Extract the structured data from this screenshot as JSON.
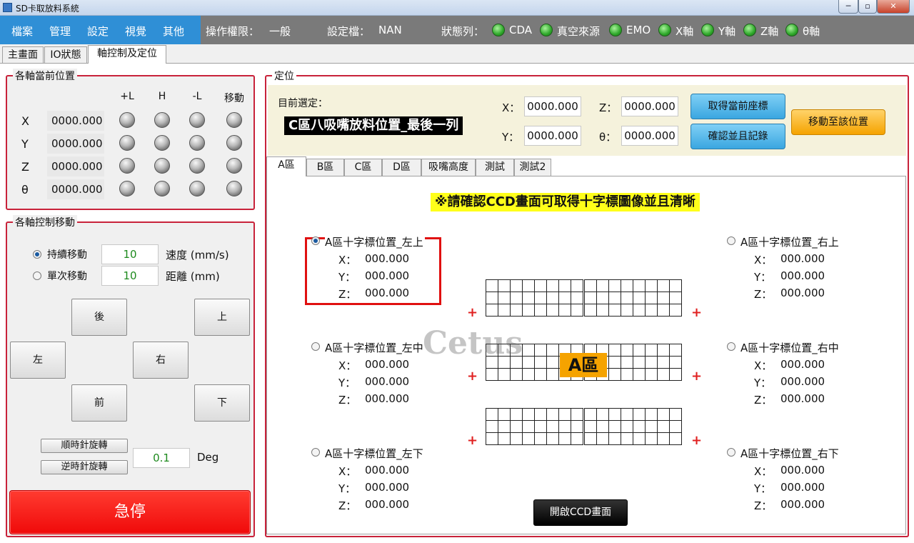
{
  "window": {
    "title": "SD卡取放料系統",
    "min": "─",
    "max": "▫",
    "close": "✕"
  },
  "menu": {
    "items": [
      "檔案",
      "管理",
      "設定",
      "視覺",
      "其他"
    ],
    "permission_label": "操作權限：",
    "permission_value": "一般",
    "setting_label": "設定檔：",
    "setting_value": "NAN",
    "status_label": "狀態列：",
    "status_items": [
      "CDA",
      "真空來源",
      "EMO",
      "X軸",
      "Y軸",
      "Z軸",
      "θ軸"
    ]
  },
  "main_tabs": [
    "主畫面",
    "IO狀態",
    "軸控制及定位"
  ],
  "active_main_tab": 2,
  "axis_position": {
    "title": "各軸當前位置",
    "columns": [
      "+L",
      "H",
      "-L",
      "移動"
    ],
    "rows": [
      {
        "axis": "X",
        "value": "0000.000"
      },
      {
        "axis": "Y",
        "value": "0000.000"
      },
      {
        "axis": "Z",
        "value": "0000.000"
      },
      {
        "axis": "θ",
        "value": "0000.000"
      }
    ]
  },
  "axis_control": {
    "title": "各軸控制移動",
    "continuous_label": "持續移動",
    "continuous_value": "10",
    "speed_unit": "速度 (mm/s)",
    "single_label": "單次移動",
    "single_value": "10",
    "distance_unit": "距離 (mm)",
    "jog": {
      "back": "後",
      "up": "上",
      "left": "左",
      "right": "右",
      "front": "前",
      "down": "下"
    },
    "cw_label": "順時針旋轉",
    "ccw_label": "逆時針旋轉",
    "deg_value": "0.1",
    "deg_unit": "Deg",
    "estop": "急停"
  },
  "positioning": {
    "title": "定位",
    "current_label": "目前選定：",
    "current_value": "C區八吸嘴放料位置_最後一列",
    "x_label": "X：",
    "x_value": "0000.000",
    "y_label": "Y：",
    "y_value": "0000.000",
    "z_label": "Z：",
    "z_value": "0000.000",
    "t_label": "θ：",
    "t_value": "0000.000",
    "get_coord": "取得當前座標",
    "confirm_record": "確認並且記錄",
    "move_to": "移動至該位置"
  },
  "sub_tabs": [
    "A區",
    "B區",
    "C區",
    "D區",
    "吸嘴高度",
    "測試",
    "測試2"
  ],
  "area": {
    "notice": "※請確認CCD畫面可取得十字標圖像並且清晰",
    "area_label": "A區",
    "watermark": "Cetus",
    "open_ccd": "開啟CCD畫面",
    "marks": [
      {
        "name": "A區十字標位置_左上",
        "x": "000.000",
        "y": "000.000",
        "z": "000.000",
        "selected": true
      },
      {
        "name": "A區十字標位置_左中",
        "x": "000.000",
        "y": "000.000",
        "z": "000.000",
        "selected": false
      },
      {
        "name": "A區十字標位置_左下",
        "x": "000.000",
        "y": "000.000",
        "z": "000.000",
        "selected": false
      },
      {
        "name": "A區十字標位置_右上",
        "x": "000.000",
        "y": "000.000",
        "z": "000.000",
        "selected": false
      },
      {
        "name": "A區十字標位置_右中",
        "x": "000.000",
        "y": "000.000",
        "z": "000.000",
        "selected": false
      },
      {
        "name": "A區十字標位置_右下",
        "x": "000.000",
        "y": "000.000",
        "z": "000.000",
        "selected": false
      }
    ],
    "x_key": "X：",
    "y_key": "Y：",
    "z_key": "Z：",
    "plus": "+"
  }
}
